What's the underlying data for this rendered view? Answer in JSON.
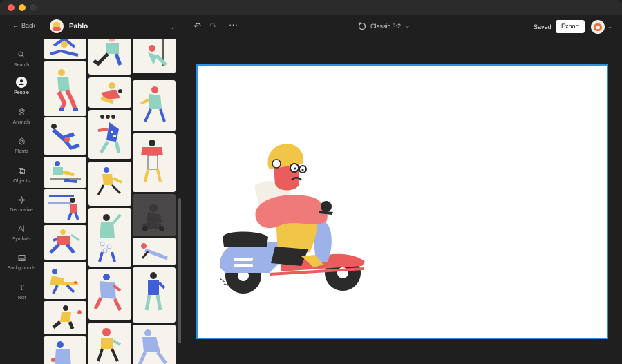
{
  "window": {
    "title": ""
  },
  "topbar": {
    "back_label": "Back",
    "pack_name": "Pablo",
    "format_label": "Classic  3:2",
    "saved_label": "Saved",
    "export_label": "Export"
  },
  "rail": {
    "items": [
      {
        "label": "Search",
        "icon": "search-icon"
      },
      {
        "label": "People",
        "icon": "person-icon",
        "active": true
      },
      {
        "label": "Animals",
        "icon": "paw-icon"
      },
      {
        "label": "Plants",
        "icon": "plant-icon"
      },
      {
        "label": "Objects",
        "icon": "objects-icon"
      },
      {
        "label": "Decorative",
        "icon": "sparkle-icon"
      },
      {
        "label": "Symbols",
        "icon": "symbols-icon"
      },
      {
        "label": "Backgrounds",
        "icon": "image-icon"
      },
      {
        "label": "Text",
        "icon": "text-icon"
      }
    ]
  },
  "gallery": {
    "thumbnail_count": 22,
    "illustration_colors": [
      "#f0c548",
      "#e95d5d",
      "#3e5fd6",
      "#8fd3c0",
      "#f3b6a2",
      "#2b2b2b"
    ]
  },
  "canvas": {
    "border_color": "#2d8ee6",
    "background": "#ffffff",
    "scooter_colors": {
      "body": "#9db2e8",
      "accent": "#e95d5d",
      "helmet": "#f0c548",
      "jacket": "#f0c548",
      "arm": "#f07a7a"
    }
  },
  "colors": {
    "accent": "#2d8ee6",
    "app_bg": "#1f1f1f"
  }
}
